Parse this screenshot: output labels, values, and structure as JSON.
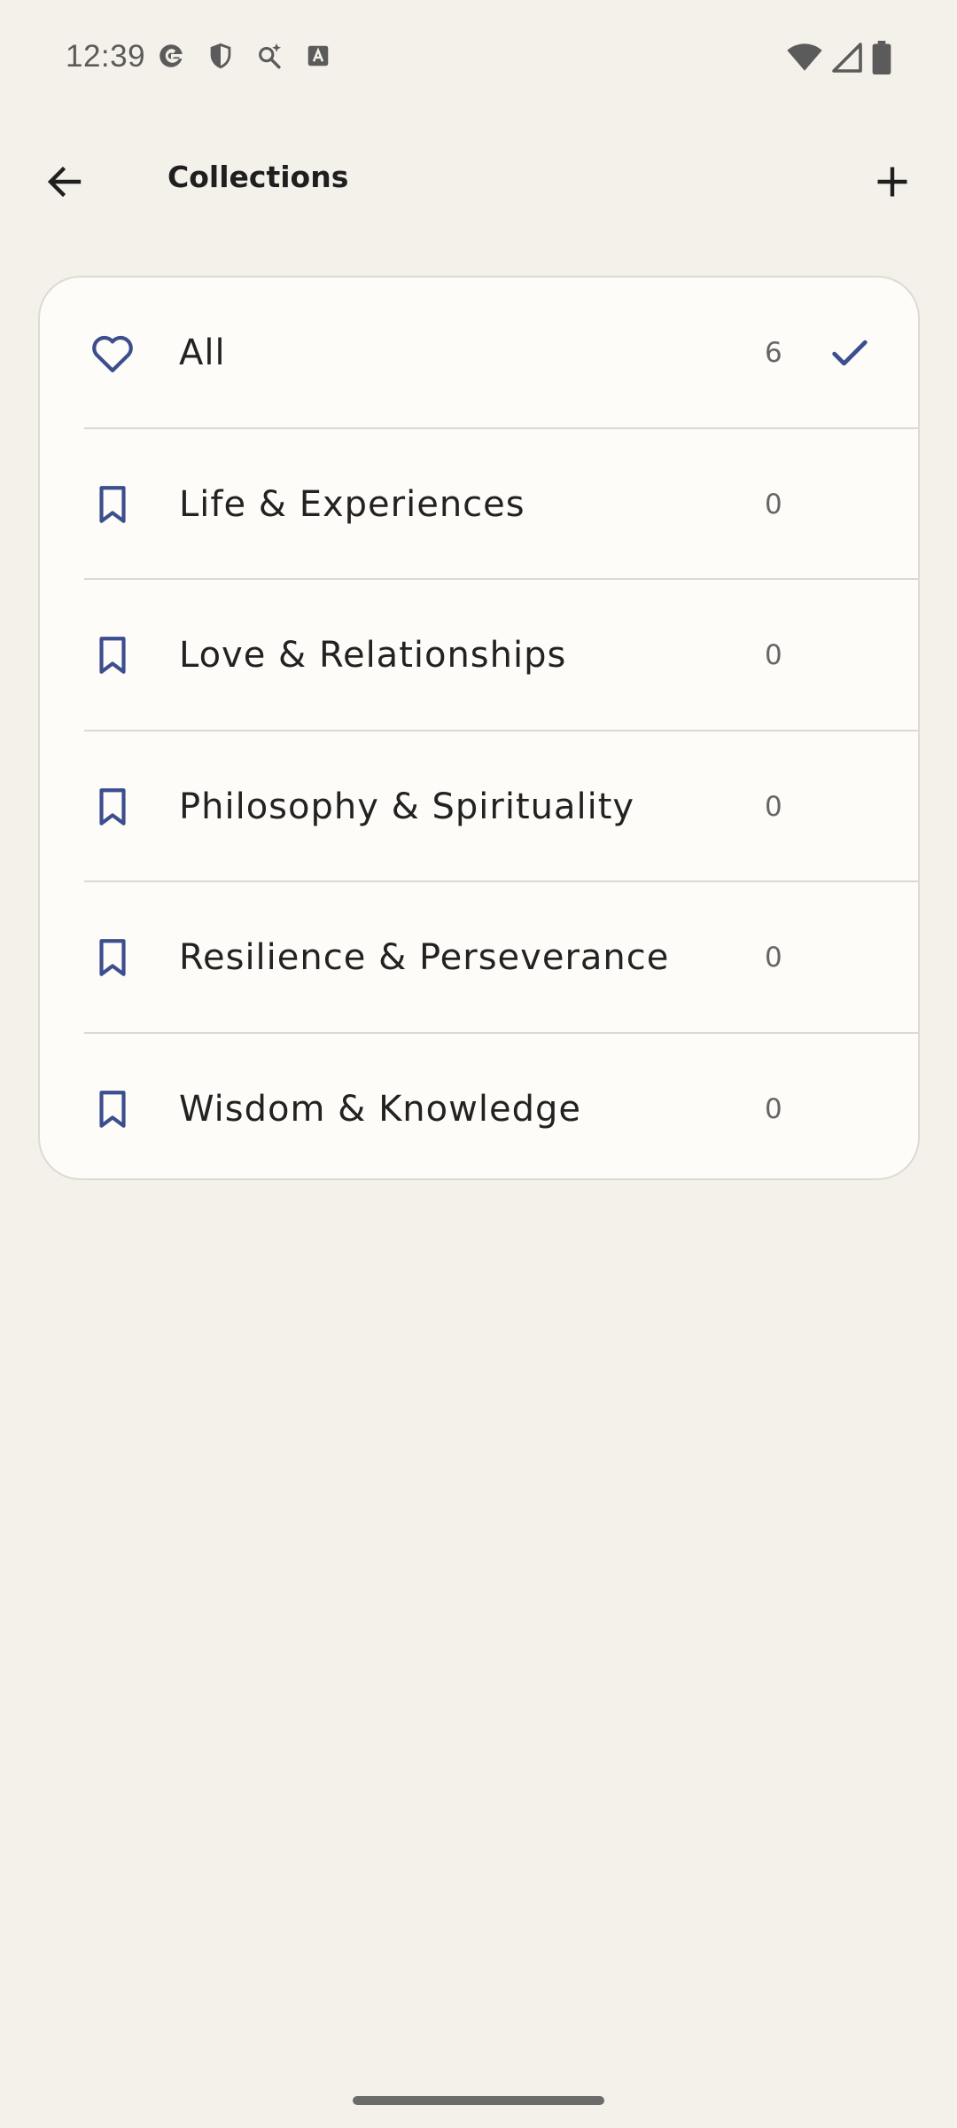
{
  "status_bar": {
    "time": "12:39",
    "icons_left": [
      "google-icon",
      "shield-icon",
      "search-sparkle-icon",
      "font-a-icon"
    ],
    "icons_right": [
      "wifi-icon",
      "signal-icon",
      "battery-icon"
    ]
  },
  "app_bar": {
    "title": "Collections",
    "back_icon": "arrow-left-icon",
    "add_icon": "plus-icon"
  },
  "collections": [
    {
      "label": "All",
      "count": "6",
      "icon": "heart-icon",
      "selected": true
    },
    {
      "label": "Life & Experiences",
      "count": "0",
      "icon": "bookmark-icon",
      "selected": false
    },
    {
      "label": "Love & Relationships",
      "count": "0",
      "icon": "bookmark-icon",
      "selected": false
    },
    {
      "label": "Philosophy & Spirituality",
      "count": "0",
      "icon": "bookmark-icon",
      "selected": false
    },
    {
      "label": "Resilience & Perseverance",
      "count": "0",
      "icon": "bookmark-icon",
      "selected": false
    },
    {
      "label": "Wisdom & Knowledge",
      "count": "0",
      "icon": "bookmark-icon",
      "selected": false
    }
  ],
  "colors": {
    "background": "#F4F0EA",
    "card": "#FDFCF8",
    "accent": "#3D4E8F",
    "text": "#222222",
    "muted": "#666666"
  }
}
